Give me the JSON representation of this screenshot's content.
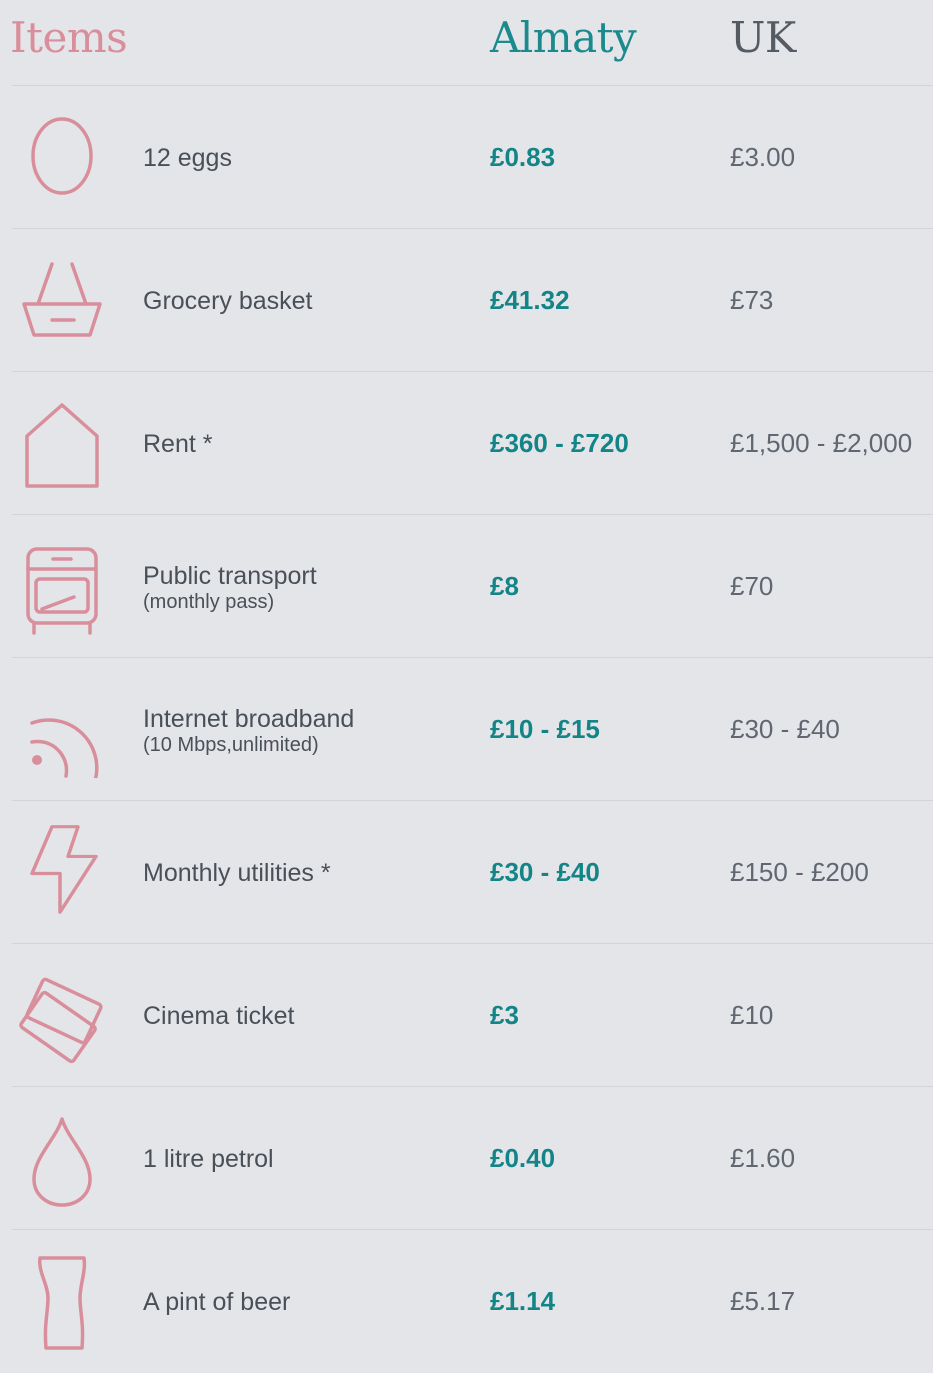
{
  "header": {
    "items": "Items",
    "almaty": "Almaty",
    "uk": "UK"
  },
  "colors": {
    "icon": "#d98e9b",
    "almaty": "#148587",
    "uk": "#606770",
    "background": "#e4e5e9"
  },
  "rows": [
    {
      "icon": "egg-icon",
      "name": "12 eggs",
      "sub": "",
      "almaty": "£0.83",
      "uk": "£3.00"
    },
    {
      "icon": "basket-icon",
      "name": "Grocery basket",
      "sub": "",
      "almaty": "£41.32",
      "uk": "£73"
    },
    {
      "icon": "house-icon",
      "name": "Rent *",
      "sub": "",
      "almaty": "£360 - £720",
      "uk": "£1,500 - £2,000"
    },
    {
      "icon": "bus-icon",
      "name": "Public transport",
      "sub": "(monthly pass)",
      "almaty": "£8",
      "uk": "£70"
    },
    {
      "icon": "wifi-icon",
      "name": "Internet broadband",
      "sub": "(10 Mbps,unlimited)",
      "almaty": "£10 - £15",
      "uk": "£30 - £40"
    },
    {
      "icon": "lightning-icon",
      "name": "Monthly utilities *",
      "sub": "",
      "almaty": "£30 - £40",
      "uk": "£150 - £200"
    },
    {
      "icon": "ticket-icon",
      "name": "Cinema ticket",
      "sub": "",
      "almaty": "£3",
      "uk": "£10"
    },
    {
      "icon": "drop-icon",
      "name": "1 litre petrol",
      "sub": "",
      "almaty": "£0.40",
      "uk": "£1.60"
    },
    {
      "icon": "pint-icon",
      "name": "A pint of beer",
      "sub": "",
      "almaty": "£1.14",
      "uk": "£5.17"
    }
  ]
}
